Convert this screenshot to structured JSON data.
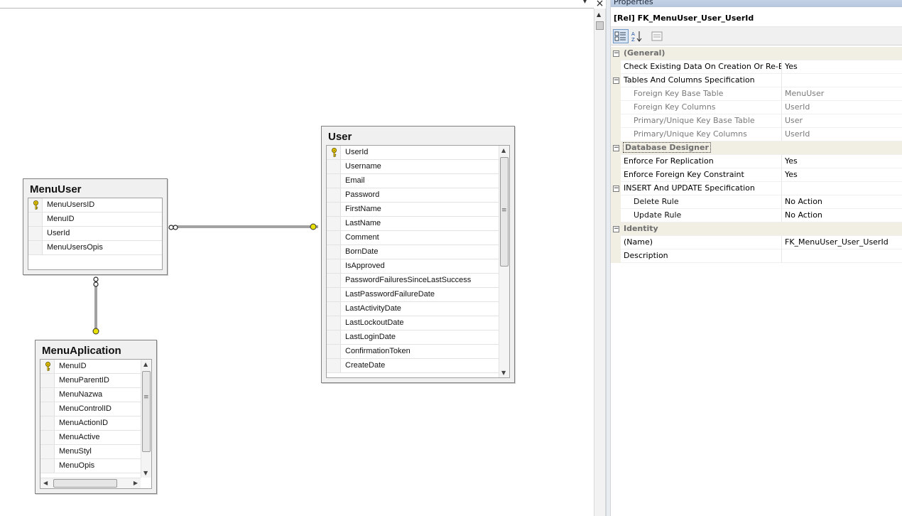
{
  "window": {
    "close_glyph": "×",
    "dropdown_glyph": "▾"
  },
  "tables": {
    "menuuser": {
      "title": "MenuUser",
      "columns": [
        {
          "name": "MenuUsersID",
          "key": true
        },
        {
          "name": "MenuID",
          "key": false
        },
        {
          "name": "UserId",
          "key": false
        },
        {
          "name": "MenuUsersOpis",
          "key": false
        }
      ]
    },
    "user": {
      "title": "User",
      "columns": [
        {
          "name": "UserId",
          "key": true
        },
        {
          "name": "Username",
          "key": false
        },
        {
          "name": "Email",
          "key": false
        },
        {
          "name": "Password",
          "key": false
        },
        {
          "name": "FirstName",
          "key": false
        },
        {
          "name": "LastName",
          "key": false
        },
        {
          "name": "Comment",
          "key": false
        },
        {
          "name": "BornDate",
          "key": false
        },
        {
          "name": "IsApproved",
          "key": false
        },
        {
          "name": "PasswordFailuresSinceLastSuccess",
          "key": false
        },
        {
          "name": "LastPasswordFailureDate",
          "key": false
        },
        {
          "name": "LastActivityDate",
          "key": false
        },
        {
          "name": "LastLockoutDate",
          "key": false
        },
        {
          "name": "LastLoginDate",
          "key": false
        },
        {
          "name": "ConfirmationToken",
          "key": false
        },
        {
          "name": "CreateDate",
          "key": false
        }
      ]
    },
    "menuaplication": {
      "title": "MenuAplication",
      "columns": [
        {
          "name": "MenuID",
          "key": true
        },
        {
          "name": "MenuParentID",
          "key": false
        },
        {
          "name": "MenuNazwa",
          "key": false
        },
        {
          "name": "MenuControlID",
          "key": false
        },
        {
          "name": "MenuActionID",
          "key": false
        },
        {
          "name": "MenuActive",
          "key": false
        },
        {
          "name": "MenuStyl",
          "key": false
        },
        {
          "name": "MenuOpis",
          "key": false
        }
      ]
    }
  },
  "properties": {
    "title": "Properties",
    "object": "[Rel] FK_MenuUser_User_UserId",
    "rows": [
      {
        "kind": "cat",
        "name": "(General)",
        "value": ""
      },
      {
        "kind": "prop",
        "name": "Check Existing Data On Creation Or Re-Enabling",
        "value": "Yes"
      },
      {
        "kind": "catplain",
        "name": "Tables And Columns Specification",
        "value": ""
      },
      {
        "kind": "subgray",
        "name": "Foreign Key Base Table",
        "value": "MenuUser"
      },
      {
        "kind": "subgray",
        "name": "Foreign Key Columns",
        "value": "UserId"
      },
      {
        "kind": "subgray",
        "name": "Primary/Unique Key Base Table",
        "value": "User"
      },
      {
        "kind": "subgray",
        "name": "Primary/Unique Key Columns",
        "value": "UserId"
      },
      {
        "kind": "catboxed",
        "name": "Database Designer",
        "value": ""
      },
      {
        "kind": "prop",
        "name": "Enforce For Replication",
        "value": "Yes"
      },
      {
        "kind": "prop",
        "name": "Enforce Foreign Key Constraint",
        "value": "Yes"
      },
      {
        "kind": "catplain",
        "name": "INSERT And UPDATE Specification",
        "value": ""
      },
      {
        "kind": "sub",
        "name": "Delete Rule",
        "value": "No Action"
      },
      {
        "kind": "sub",
        "name": "Update Rule",
        "value": "No Action"
      },
      {
        "kind": "cat",
        "name": "Identity",
        "value": ""
      },
      {
        "kind": "prop",
        "name": "(Name)",
        "value": "FK_MenuUser_User_UserId"
      },
      {
        "kind": "prop",
        "name": "Description",
        "value": ""
      }
    ]
  }
}
